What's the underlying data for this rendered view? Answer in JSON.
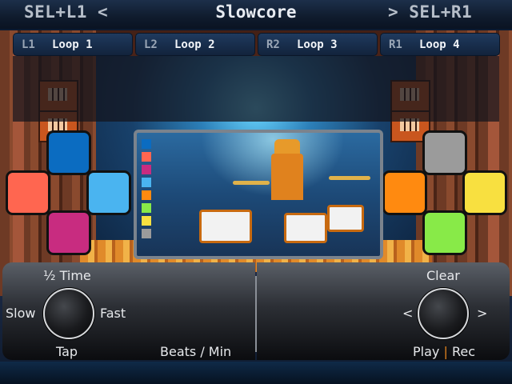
{
  "header": {
    "left_nav": "SEL+L1 <",
    "title": "Slowcore",
    "right_nav": "> SEL+R1"
  },
  "loops": [
    {
      "key": "L1",
      "label": "Loop 1"
    },
    {
      "key": "L2",
      "label": "Loop 2"
    },
    {
      "key": "R2",
      "label": "Loop 3"
    },
    {
      "key": "R1",
      "label": "Loop 4"
    }
  ],
  "pads": {
    "left": {
      "top": "#0b6cc1",
      "left": "#ff6650",
      "right": "#4ab4f0",
      "bottom": "#c82c80"
    },
    "right": {
      "top": "#9b9b9b",
      "left": "#ff8a10",
      "right": "#f8e040",
      "bottom": "#88ea48"
    }
  },
  "preview": {
    "swatches": [
      "#0b6cc1",
      "#ff6650",
      "#c82c80",
      "#4ab4f0",
      "#ff8a10",
      "#88ea48",
      "#f8e040",
      "#9b9b9b"
    ]
  },
  "tempo": {
    "top_label": "½ Time",
    "slow_label": "Slow",
    "fast_label": "Fast",
    "tap_label": "Tap",
    "unit_label": "Beats / Min"
  },
  "recorder": {
    "clear_label": "Clear",
    "prev_label": "<",
    "next_label": ">",
    "play_label": "Play",
    "separator": "|",
    "rec_label": "Rec"
  }
}
